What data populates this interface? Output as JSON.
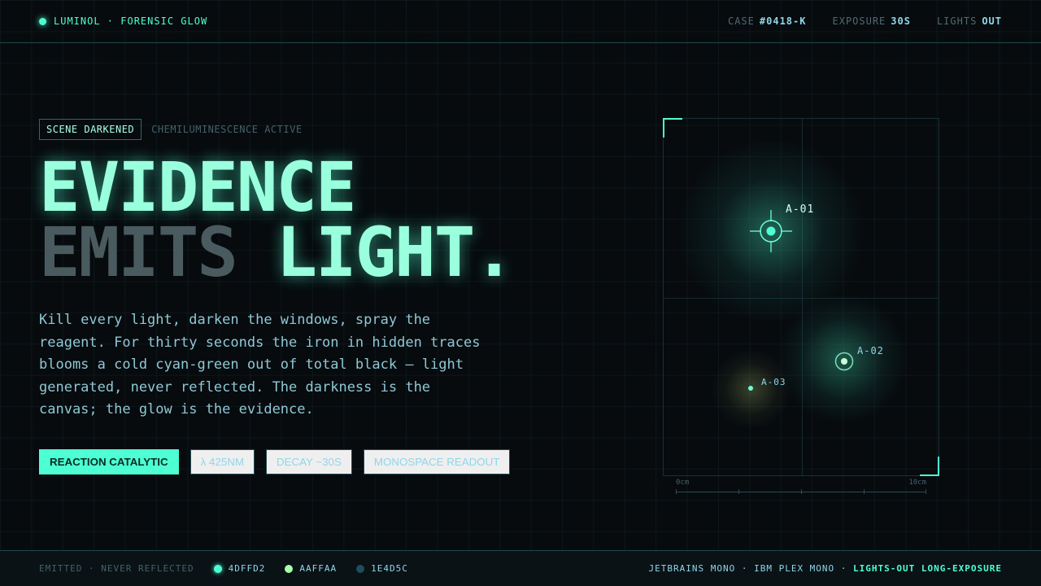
{
  "topbar": {
    "brand": "LUMINOL · FORENSIC GLOW",
    "meta": [
      {
        "label": "CASE",
        "value": "#0418-K"
      },
      {
        "label": "EXPOSURE",
        "value": "30S"
      },
      {
        "label": "LIGHTS",
        "value": "OUT"
      }
    ]
  },
  "hero": {
    "badge": "SCENE DARKENED",
    "badge_sub": "CHEMILUMINESCENCE ACTIVE",
    "line1": "EVIDENCE",
    "line2_dim": "EMITS",
    "line2_glow": "LIGHT.",
    "body": "Kill every light, darken the windows, spray the reagent. For thirty seconds the iron in hidden traces blooms a cold cyan-green out of total black — light generated, never reflected. The darkness is the canvas; the glow is the evidence.",
    "chips": [
      "REACTION CATALYTIC",
      "λ 425NM",
      "DECAY ~30S",
      "MONOSPACE READOUT"
    ]
  },
  "panel": {
    "markers": [
      "A-01",
      "A-02",
      "A-03"
    ],
    "scale_start": "0cm",
    "scale_end": "10cm"
  },
  "bottombar": {
    "tagline": "EMITTED · NEVER REFLECTED",
    "swatches": [
      {
        "label": "4DFFD2",
        "color": "#4dffd2"
      },
      {
        "label": "AAFFAA",
        "color": "#aaffaa"
      },
      {
        "label": "1E4D5C",
        "color": "#1e4d5c"
      }
    ],
    "fonts": "JETBRAINS MONO · IBM PLEX MONO · ",
    "mode": "LIGHTS-OUT LONG-EXPOSURE"
  },
  "colors": {
    "accent": "#4dffd2",
    "secondary": "#aaffaa",
    "deep": "#1e4d5c"
  }
}
